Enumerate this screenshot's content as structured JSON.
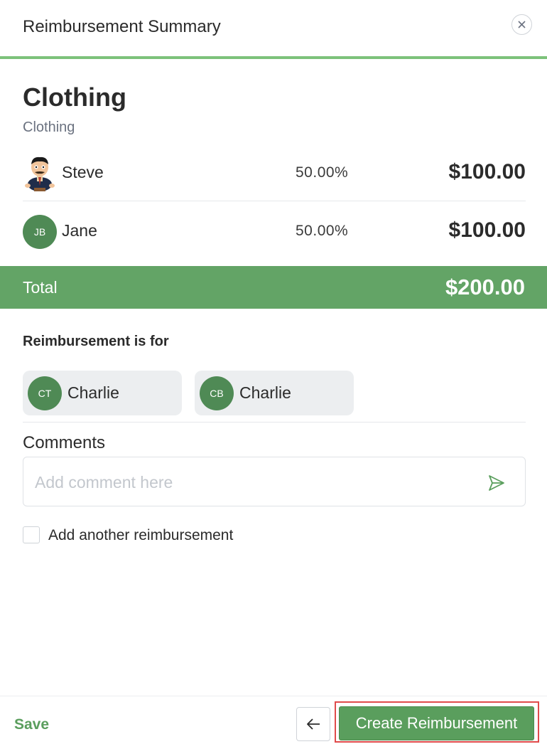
{
  "header": {
    "title": "Reimbursement Summary",
    "close_icon": "close-icon",
    "accent_color": "#7cc27a"
  },
  "category": {
    "title": "Clothing",
    "subtitle": "Clothing"
  },
  "splits": [
    {
      "name": "Steve",
      "avatar": "cartoon-avatar",
      "percent": "50.00%",
      "amount": "$100.00"
    },
    {
      "name": "Jane",
      "initials": "JB",
      "percent": "50.00%",
      "amount": "$100.00"
    }
  ],
  "total": {
    "label": "Total",
    "amount": "$200.00",
    "bar_color": "#63a466"
  },
  "reimbursement_for": {
    "label": "Reimbursement is for",
    "people": [
      {
        "initials": "CT",
        "name": "Charlie"
      },
      {
        "initials": "CB",
        "name": "Charlie"
      }
    ]
  },
  "comments": {
    "label": "Comments",
    "placeholder": "Add comment here",
    "value": "",
    "send_icon": "send-icon"
  },
  "add_another": {
    "label": "Add another reimbursement",
    "checked": false
  },
  "footer": {
    "save_label": "Save",
    "back_icon": "arrow-left-icon",
    "create_label": "Create Reimbursement",
    "brand_color": "#5a9e5d",
    "highlight_color": "#e04b4b"
  }
}
